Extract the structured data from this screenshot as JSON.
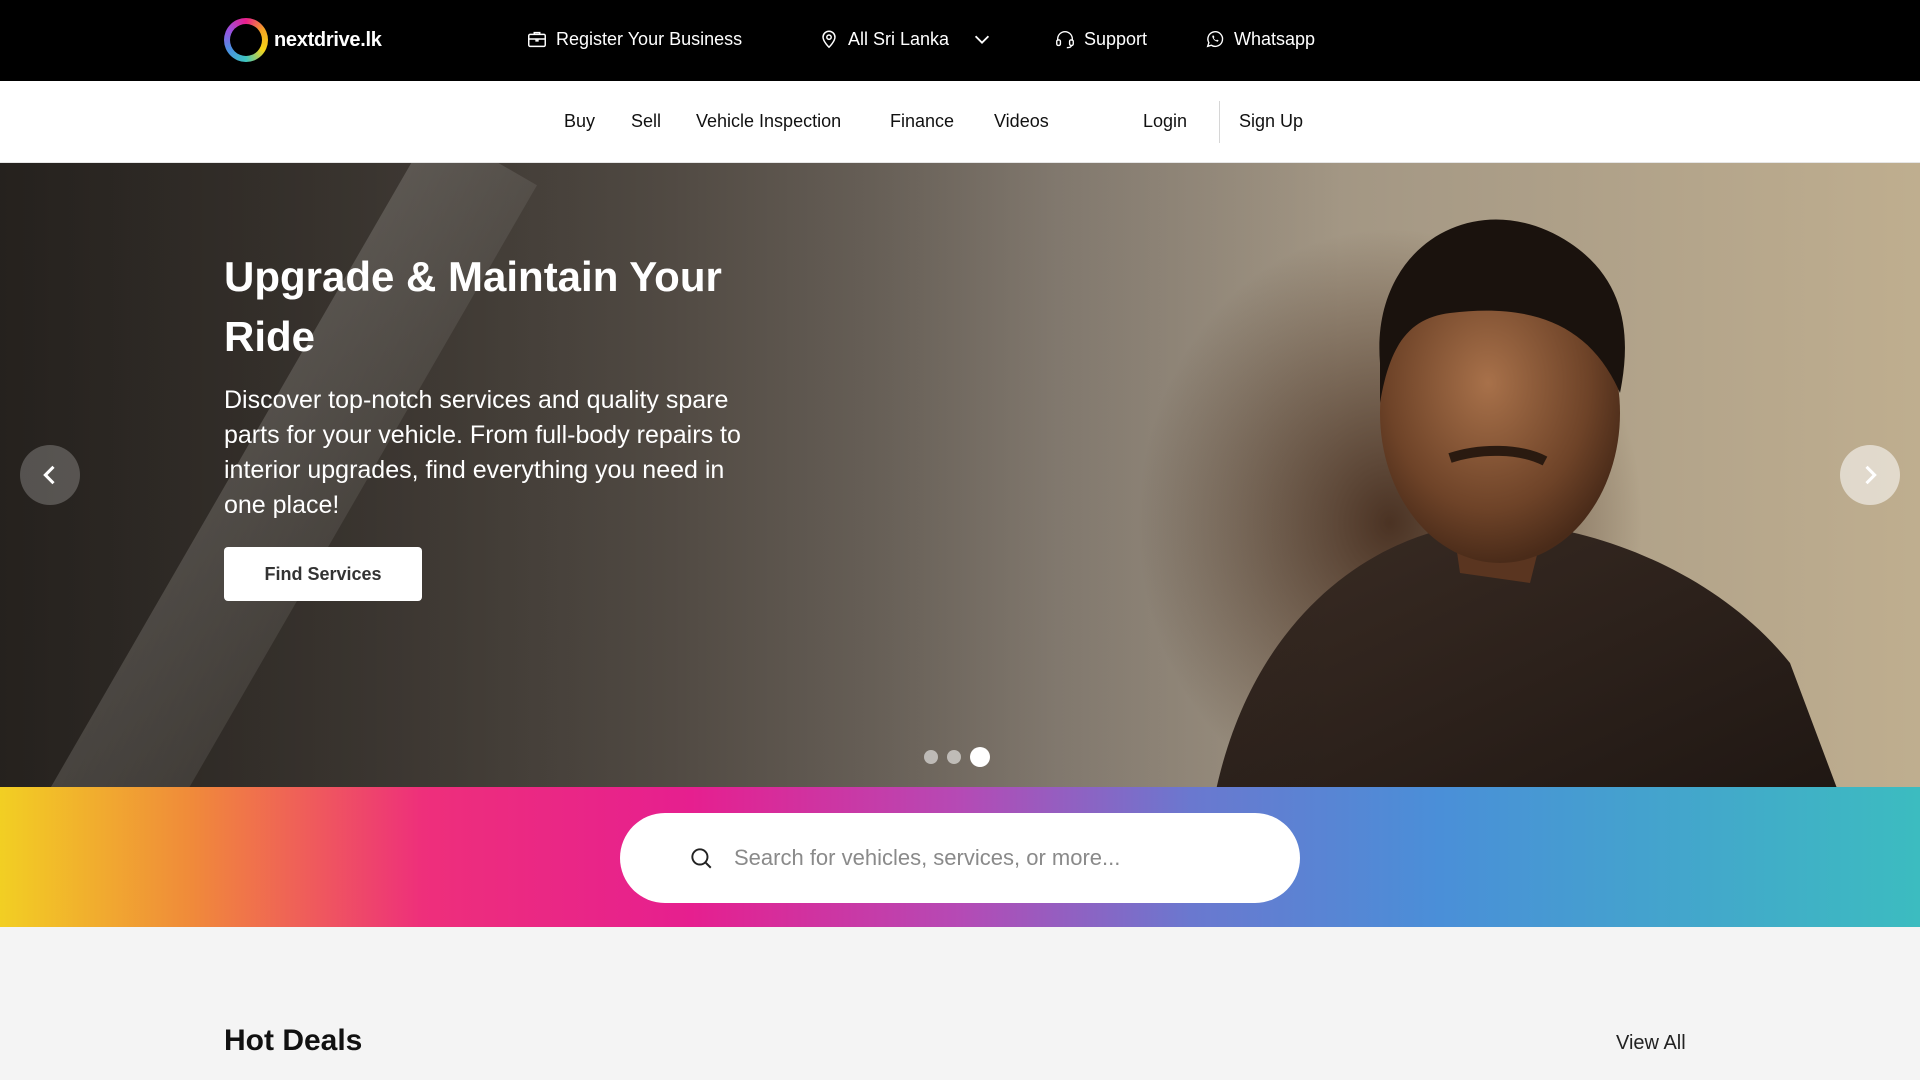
{
  "topbar": {
    "logo_text": "nextdrive.lk",
    "register": "Register Your Business",
    "location": "All Sri Lanka",
    "support": "Support",
    "whatsapp": "Whatsapp"
  },
  "nav": {
    "items": [
      "Buy",
      "Sell",
      "Vehicle Inspection",
      "Finance",
      "Videos"
    ],
    "login": "Login",
    "signup": "Sign Up"
  },
  "hero": {
    "title": "Upgrade & Maintain Your Ride",
    "description": "Discover top-notch services and quality spare parts for your vehicle. From full-body repairs to interior upgrades, find everything you need in one place!",
    "button": "Find Services",
    "slide_count": 3,
    "active_slide": 3
  },
  "search": {
    "placeholder": "Search for vehicles, services, or more..."
  },
  "hot_deals": {
    "title": "Hot Deals",
    "view_all": "View All"
  },
  "colors": {
    "topbar_bg": "#000000",
    "band_start": "#f2cf23",
    "band_mid": "#e61f8f",
    "band_end": "#3cbcc0"
  },
  "icons": [
    "briefcase-icon",
    "location-pin-icon",
    "chevron-down-icon",
    "headset-icon",
    "whatsapp-icon",
    "search-icon",
    "arrow-left-icon",
    "arrow-right-icon"
  ]
}
